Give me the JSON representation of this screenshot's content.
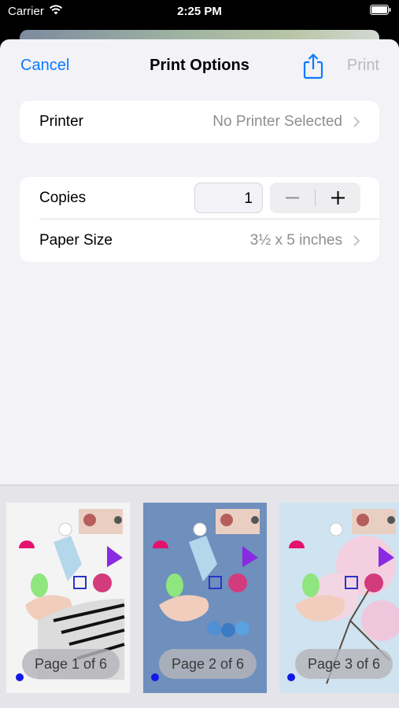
{
  "status_bar": {
    "carrier": "Carrier",
    "time": "2:25 PM"
  },
  "nav": {
    "cancel": "Cancel",
    "title": "Print Options",
    "print": "Print",
    "share_icon": "share-icon"
  },
  "printer": {
    "label": "Printer",
    "value": "No Printer Selected"
  },
  "copies": {
    "label": "Copies",
    "value": "1"
  },
  "paper_size": {
    "label": "Paper Size",
    "value": "3½ x 5 inches"
  },
  "pages": [
    {
      "label": "Page 1 of 6",
      "background": "#f4f4f4"
    },
    {
      "label": "Page 2 of 6",
      "background": "#6f8fbd"
    },
    {
      "label": "Page 3 of 6",
      "background": "#cfe3f0"
    }
  ],
  "colors": {
    "accent": "#0a7aff",
    "disabled": "#b9b9be"
  }
}
